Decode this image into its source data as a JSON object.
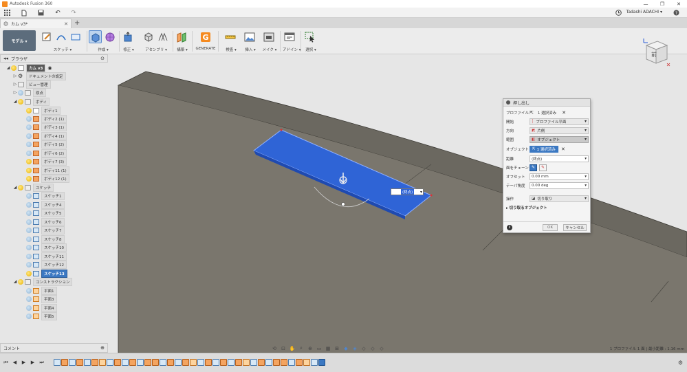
{
  "app": {
    "title": "Autodesk Fusion 360",
    "user": "Tadashi ADACHI ▾",
    "window_controls": [
      "—",
      "❐",
      "✕"
    ]
  },
  "document_tab": {
    "name": "カム v3*",
    "close": "✕",
    "add": "+"
  },
  "ribbon": {
    "workspace": "モデル ▾",
    "groups": [
      {
        "label": "スケッチ ▾"
      },
      {
        "label": "作成 ▾"
      },
      {
        "label": "修正 ▾"
      },
      {
        "label": "アセンブリ ▾"
      },
      {
        "label": "構築 ▾"
      },
      {
        "label": "GENERATE"
      },
      {
        "label": "検査 ▾"
      },
      {
        "label": "挿入 ▾"
      },
      {
        "label": "メイク ▾"
      },
      {
        "label": "アドイン ▾"
      },
      {
        "label": "選択 ▾"
      }
    ]
  },
  "browser": {
    "title": "ブラウザ",
    "root": "カム v3",
    "items": [
      {
        "label": "ドキュメントの設定",
        "level": 1,
        "icon": "gear"
      },
      {
        "label": "ビュー管理",
        "level": 1,
        "icon": "folder"
      },
      {
        "label": "原点",
        "level": 1,
        "icon": "folder"
      },
      {
        "label": "ボディ",
        "level": 1,
        "icon": "folder"
      },
      {
        "label": "ボディ1",
        "level": 2,
        "icon": "body"
      },
      {
        "label": "ボディ2 (1)",
        "level": 2,
        "icon": "body"
      },
      {
        "label": "ボディ3 (1)",
        "level": 2,
        "icon": "body"
      },
      {
        "label": "ボディ4 (1)",
        "level": 2,
        "icon": "body"
      },
      {
        "label": "ボディ5 (2)",
        "level": 2,
        "icon": "body"
      },
      {
        "label": "ボディ6 (2)",
        "level": 2,
        "icon": "body"
      },
      {
        "label": "ボディ7 (3)",
        "level": 2,
        "icon": "body"
      },
      {
        "label": "ボディ11 (1)",
        "level": 2,
        "icon": "body"
      },
      {
        "label": "ボディ12 (1)",
        "level": 2,
        "icon": "body"
      },
      {
        "label": "スケッチ",
        "level": 1,
        "icon": "folder"
      },
      {
        "label": "スケッチ1",
        "level": 2,
        "icon": "sketch"
      },
      {
        "label": "スケッチ4",
        "level": 2,
        "icon": "sketch"
      },
      {
        "label": "スケッチ5",
        "level": 2,
        "icon": "sketch"
      },
      {
        "label": "スケッチ6",
        "level": 2,
        "icon": "sketch"
      },
      {
        "label": "スケッチ7",
        "level": 2,
        "icon": "sketch"
      },
      {
        "label": "スケッチ8",
        "level": 2,
        "icon": "sketch"
      },
      {
        "label": "スケッチ10",
        "level": 2,
        "icon": "sketch"
      },
      {
        "label": "スケッチ11",
        "level": 2,
        "icon": "sketch"
      },
      {
        "label": "スケッチ12",
        "level": 2,
        "icon": "sketch"
      },
      {
        "label": "スケッチ13",
        "level": 2,
        "icon": "sketch",
        "selected": true
      },
      {
        "label": "コンストラクション",
        "level": 1,
        "icon": "folder"
      },
      {
        "label": "平面1",
        "level": 2,
        "icon": "plane"
      },
      {
        "label": "平面3",
        "level": 2,
        "icon": "plane"
      },
      {
        "label": "平面4",
        "level": 2,
        "icon": "plane"
      },
      {
        "label": "平面5",
        "level": 2,
        "icon": "plane"
      }
    ]
  },
  "comments": {
    "title": "コメント"
  },
  "dialog": {
    "title": "押し出し",
    "rows": [
      {
        "label": "プロファイル",
        "value": "1 選択済み",
        "kind": "chip-plain",
        "clear": "✕"
      },
      {
        "label": "開始",
        "value": "プロファイル平面",
        "kind": "dropdown"
      },
      {
        "label": "方向",
        "value": "片側",
        "kind": "dropdown"
      },
      {
        "label": "範囲",
        "value": "オブジェクト",
        "kind": "dropdown-selected"
      },
      {
        "label": "オブジェクト",
        "value": "1 選択済み",
        "kind": "chip-blue",
        "clear": "✕"
      },
      {
        "label": "距離",
        "value": "(終点)",
        "kind": "input"
      },
      {
        "label": "面をチェーン",
        "value": "",
        "kind": "toggles"
      },
      {
        "label": "オフセット",
        "value": "0.00 mm",
        "kind": "input"
      },
      {
        "label": "テーパ角度",
        "value": "0.00 deg",
        "kind": "input"
      },
      {
        "label": "操作",
        "value": "切り取り",
        "kind": "dropdown"
      }
    ],
    "section": "▸ 切り取るオブジェクト",
    "ok": "OK",
    "cancel": "キャンセル",
    "info": "i"
  },
  "canvas": {
    "distance_field": "(終点)",
    "body_color": "#78746b",
    "profile_color": "#2f64d6"
  },
  "viewcube": {
    "face": "前"
  },
  "status_text": "1 プロファイル 1 面 | 最小距離 : 1.16 mm",
  "colors": {
    "accent": "#3b78c2",
    "profile": "#2f64d6",
    "body": "#78746b"
  }
}
